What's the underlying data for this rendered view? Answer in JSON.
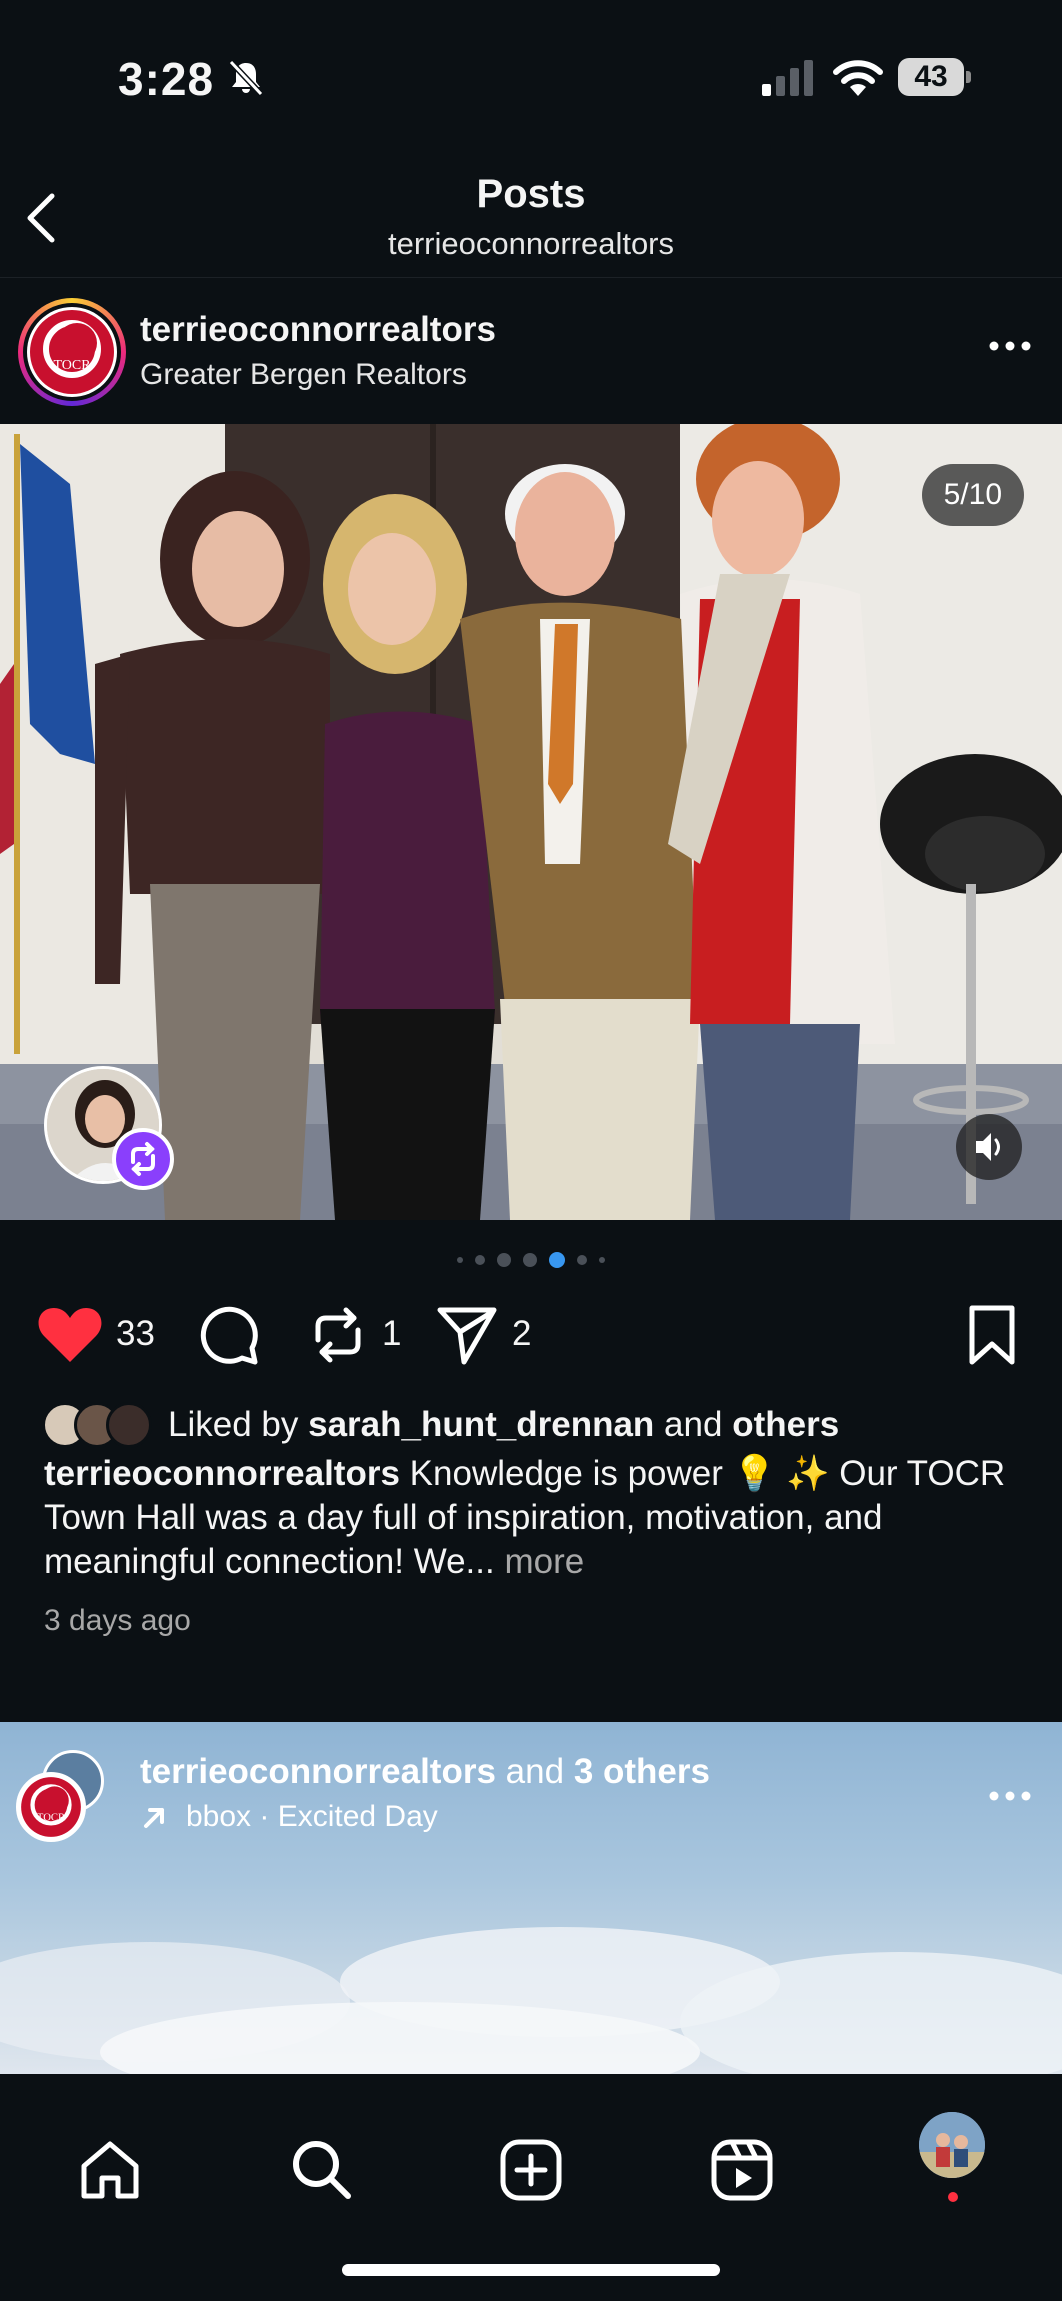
{
  "status_bar": {
    "time": "3:28",
    "battery": "43"
  },
  "header": {
    "title": "Posts",
    "subtitle": "terrieoconnorrealtors"
  },
  "post": {
    "username": "terrieoconnorrealtors",
    "location": "Greater Bergen Realtors",
    "avatar_text": "TOCR",
    "counter": "5/10",
    "likes": "33",
    "reposts": "1",
    "shares": "2",
    "liked_by_prefix": "Liked by",
    "liked_by_user": "sarah_hunt_drennan",
    "liked_by_and": "and",
    "liked_by_others": "others",
    "caption_user": "terrieoconnorrealtors",
    "caption_text": "Knowledge is power 💡 ✨ Our TOCR Town Hall was a day full of inspiration, motivation, and meaningful connection! We...",
    "caption_more": "more",
    "time_ago": "3 days ago"
  },
  "next_post": {
    "user": "terrieoconnorrealtors",
    "and_text": "and",
    "others": "3 others",
    "audio": "bbox · Excited Day",
    "avatar_text": "TOCR"
  },
  "colors": {
    "background": "#0b1014",
    "like_red": "#ff3040",
    "dot_active": "#3897f0",
    "repost_purple": "#8a3ffc"
  },
  "icons": [
    "bell-off-icon",
    "signal-icon",
    "wifi-icon",
    "back-icon",
    "more-icon",
    "volume-icon",
    "repost-icon",
    "heart-icon",
    "comment-icon",
    "share-icon",
    "bookmark-icon",
    "arrow-icon",
    "home-icon",
    "search-icon",
    "create-icon",
    "reels-icon"
  ]
}
